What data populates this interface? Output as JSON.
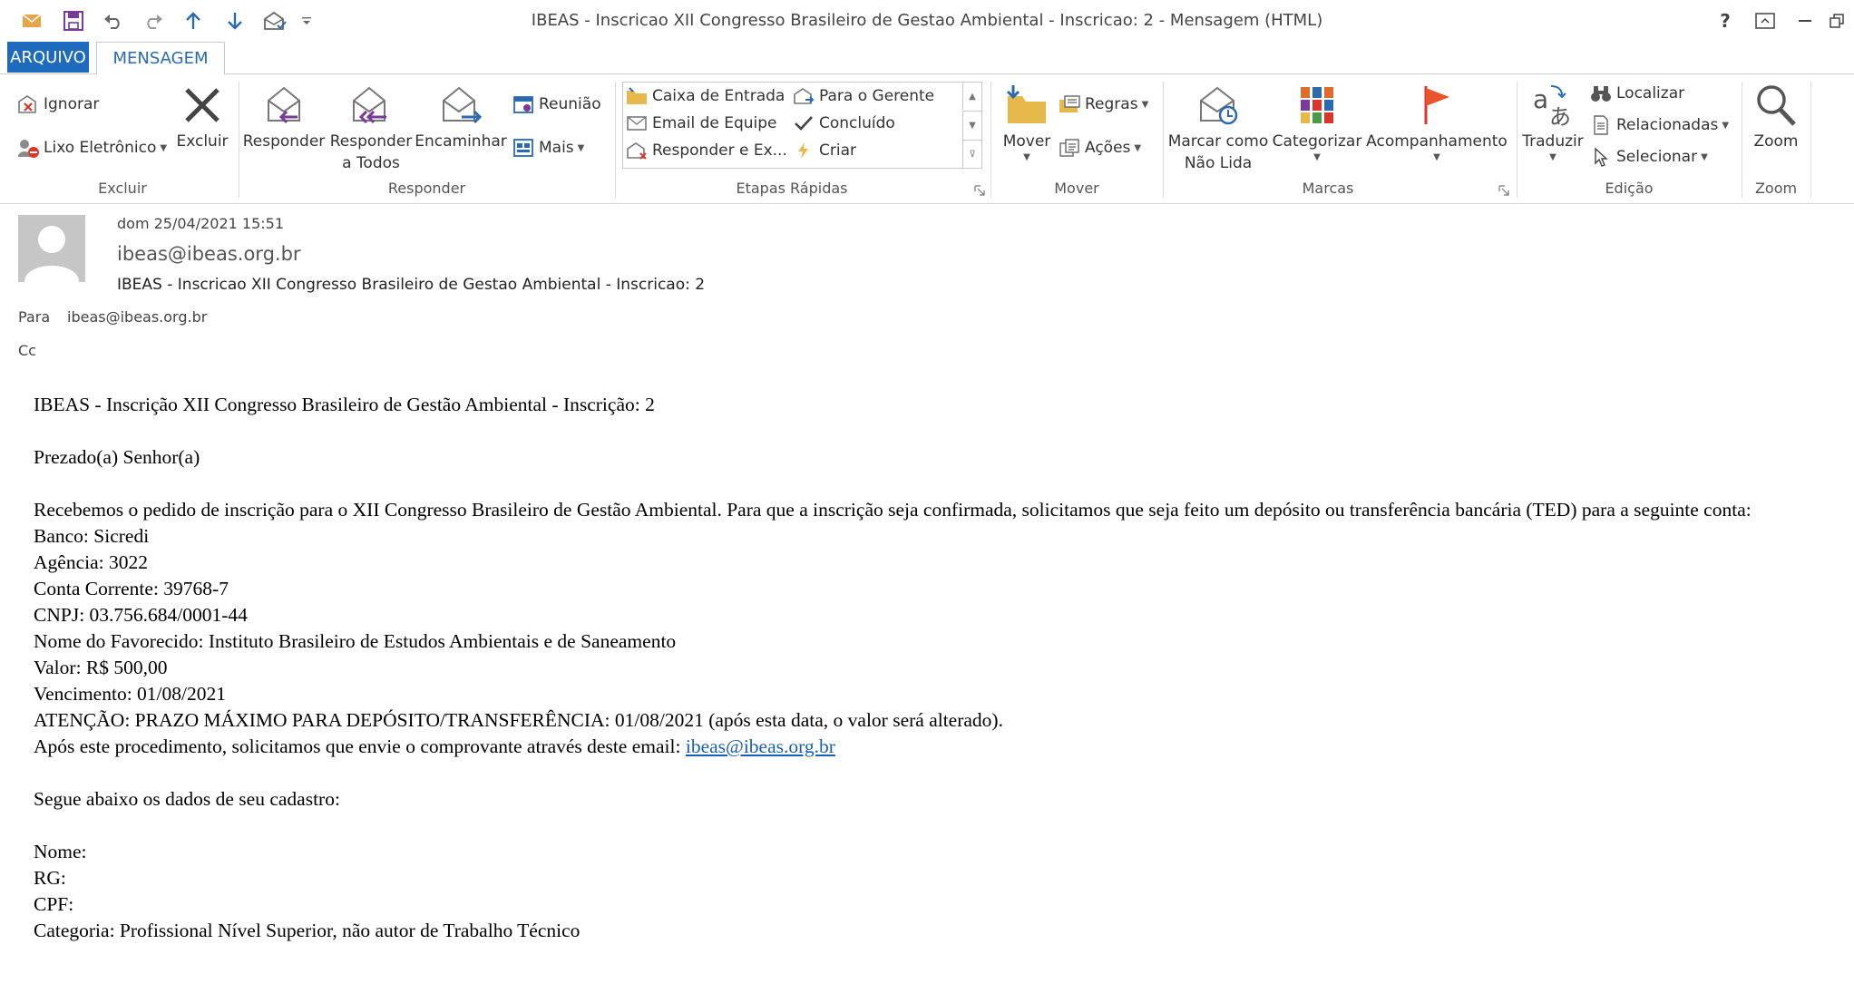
{
  "window": {
    "title": "IBEAS - Inscricao XII Congresso Brasileiro de Gestao Ambiental - Inscricao: 2 - Mensagem (HTML)",
    "help": "?",
    "accent": "#1e6bbd"
  },
  "quick_access": [
    "envelope-icon",
    "save-icon",
    "undo-icon",
    "redo-icon",
    "up-arrow-icon",
    "down-arrow-icon",
    "envelope-check-icon",
    "customize-icon"
  ],
  "tabs": {
    "file": "ARQUIVO",
    "message": "MENSAGEM"
  },
  "ribbon": {
    "excluir": {
      "ignorar": "Ignorar",
      "lixo": "Lixo Eletrônico",
      "excluir": "Excluir",
      "label": "Excluir"
    },
    "responder": {
      "responder": "Responder",
      "responder_todos_1": "Responder",
      "responder_todos_2": "a Todos",
      "encaminhar": "Encaminhar",
      "reuniao": "Reunião",
      "mais": "Mais",
      "label": "Responder"
    },
    "etapas": {
      "caixa": "Caixa de Entrada",
      "equipe": "Email de Equipe",
      "responder_ex": "Responder e Ex...",
      "gerente": "Para o Gerente",
      "concluido": "Concluído",
      "criar": "Criar",
      "label": "Etapas Rápidas"
    },
    "mover": {
      "mover": "Mover",
      "regras": "Regras",
      "acoes": "Ações",
      "label": "Mover"
    },
    "marcas": {
      "marcar_1": "Marcar como",
      "marcar_2": "Não Lida",
      "categorizar": "Categorizar",
      "acompanhamento": "Acompanhamento",
      "label": "Marcas"
    },
    "edicao": {
      "traduzir": "Traduzir",
      "localizar": "Localizar",
      "relacionadas": "Relacionadas",
      "selecionar": "Selecionar",
      "label": "Edição"
    },
    "zoom": {
      "zoom": "Zoom",
      "label": "Zoom"
    }
  },
  "header": {
    "date": "dom 25/04/2021 15:51",
    "sender": "ibeas@ibeas.org.br",
    "subject": "IBEAS - Inscricao XII Congresso Brasileiro de Gestao Ambiental - Inscricao: 2",
    "to_label": "Para",
    "to": "ibeas@ibeas.org.br",
    "cc_label": "Cc"
  },
  "body": {
    "title": "IBEAS - Inscrição XII Congresso Brasileiro de Gestão Ambiental - Inscrição: 2",
    "greeting": "Prezado(a) Senhor(a)",
    "intro": "Recebemos o pedido de inscrição para o XII Congresso Brasileiro de Gestão Ambiental. Para que a inscrição seja confirmada, solicitamos que seja feito um depósito ou transferência bancária (TED) para a seguinte conta:",
    "banco": "Banco: Sicredi",
    "agencia": "Agência: 3022",
    "conta": "Conta Corrente: 39768-7",
    "cnpj": "CNPJ: 03.756.684/0001-44",
    "favorecido": "Nome do Favorecido: Instituto Brasileiro de Estudos Ambientais e de Saneamento",
    "valor": "Valor: R$ 500,00",
    "vencimento": "Vencimento: 01/08/2021",
    "atencao": "ATENÇÃO: PRAZO MÁXIMO PARA DEPÓSITO/TRANSFERÊNCIA: 01/08/2021 (após esta data, o valor será alterado).",
    "apos_prefix": "Após este procedimento, solicitamos que envie o comprovante através deste email: ",
    "apos_link": "ibeas@ibeas.org.br",
    "segue": "Segue abaixo os dados de seu cadastro:",
    "nome": "Nome:",
    "rg": "RG:",
    "cpf": "CPF:",
    "categoria": "Categoria: Profissional Nível Superior, não autor de Trabalho Técnico"
  }
}
